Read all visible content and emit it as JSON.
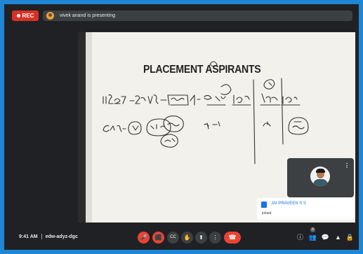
{
  "recording": {
    "label": "REC"
  },
  "presenting": {
    "text": "vivek anand is presenting"
  },
  "slide": {
    "title": "PLACEMENT ASPIRANTS"
  },
  "self_view": {
    "more_label": "⋮"
  },
  "toast": {
    "name": "JAI PRAVEEN S S",
    "message": "joined"
  },
  "meeting": {
    "time": "9:41 AM",
    "code": "edw-adyz-dgc"
  },
  "controls": [
    {
      "name": "mic",
      "glyph": "🎤"
    },
    {
      "name": "camera",
      "glyph": "⬛"
    },
    {
      "name": "captions",
      "glyph": "CC"
    },
    {
      "name": "raise-hand",
      "glyph": "✋"
    },
    {
      "name": "present",
      "glyph": "⬆"
    },
    {
      "name": "more-options",
      "glyph": "⋮"
    },
    {
      "name": "end-call",
      "glyph": "☎"
    }
  ],
  "right_controls": [
    {
      "name": "info",
      "glyph": "ⓘ"
    },
    {
      "name": "people",
      "glyph": "👥",
      "count": "0"
    },
    {
      "name": "chat",
      "glyph": "💬"
    },
    {
      "name": "activities",
      "glyph": "▲"
    },
    {
      "name": "host-controls",
      "glyph": "🔒"
    }
  ],
  "colors": {
    "border": "#1f86d6",
    "background": "#202124",
    "danger": "#ea4335",
    "button": "#3c4043"
  }
}
